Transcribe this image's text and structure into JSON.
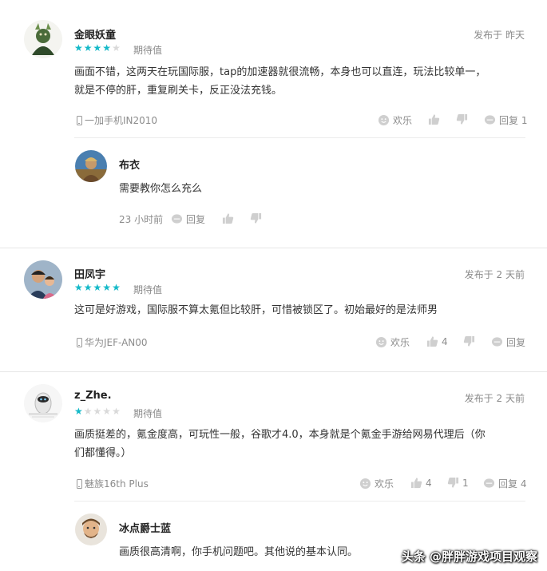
{
  "reviews": [
    {
      "user": "金眼妖童",
      "rating": 4,
      "rating_label": "期待值",
      "posted": "发布于 昨天",
      "content_lines": [
        "画面不错，这两天在玩国际服，tap的加速器就很流畅，本身也可以直连，玩法比较单一，",
        "就是不停的肝，重复刷关卡，反正没法充钱。"
      ],
      "device": "一加手机IN2010",
      "fun_label": "欢乐",
      "like_count": "",
      "dislike_count": "",
      "reply_label": "回复 1",
      "replies": [
        {
          "user": "布衣",
          "content": "需要教你怎么充么",
          "time": "23 小时前",
          "reply_label": "回复"
        }
      ]
    },
    {
      "user": "田凤宇",
      "rating": 5,
      "rating_label": "期待值",
      "posted": "发布于 2 天前",
      "content_lines": [
        "这可是好游戏，国际服不算太氪但比较肝，可惜被锁区了。初始最好的是法师男"
      ],
      "device": "华为JEF-AN00",
      "fun_label": "欢乐",
      "like_count": "4",
      "dislike_count": "",
      "reply_label": "回复"
    },
    {
      "user": "z_Zhe.",
      "rating": 1,
      "rating_label": "期待值",
      "posted": "发布于 2 天前",
      "content_lines": [
        "画质挺差的，氪金度高，可玩性一般，谷歌才4.0，本身就是个氪金手游给网易代理后（你",
        "们都懂得。）"
      ],
      "device": "魅族16th Plus",
      "fun_label": "欢乐",
      "like_count": "4",
      "dislike_count": "1",
      "reply_label": "回复 4",
      "replies": [
        {
          "user": "冰点爵士蓝",
          "content": "画质很高清啊，你手机问题吧。其他说的基本认同。"
        }
      ]
    }
  ],
  "watermark": "头条 @胖胖游戏项目观察",
  "colors": {
    "star_on": "#14b9c8",
    "star_off": "#d9d9d9",
    "text_muted": "#8c8c8c"
  }
}
